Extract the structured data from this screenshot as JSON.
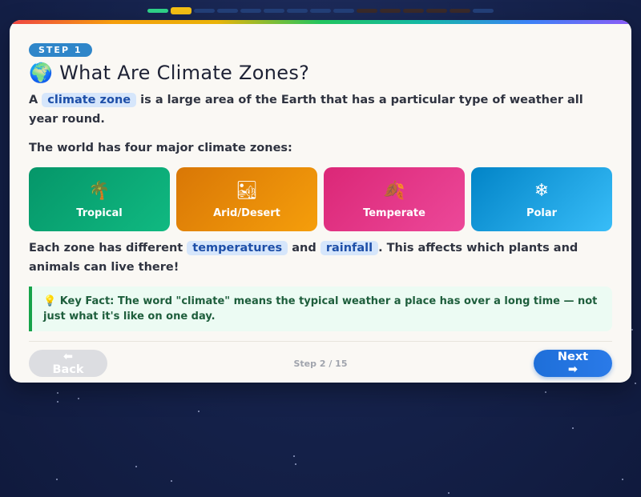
{
  "progress": {
    "total": 15,
    "done": 1,
    "current": 2,
    "dark_from": 10,
    "dark_to": 14
  },
  "step_badge": "STEP 1",
  "title": {
    "icon": "globe-icon",
    "text": "🌍 What Are Climate Zones?"
  },
  "intro": {
    "prefix": "A",
    "highlight": "climate zone",
    "suffix": "is a large area of the Earth that has a particular type of weather all year round."
  },
  "zones_heading": "The world has four major climate zones:",
  "zones": [
    {
      "icon": "🌴",
      "icon_name": "palm-tree-icon",
      "label": "Tropical"
    },
    {
      "icon": "🏜",
      "icon_name": "desert-icon",
      "label": "Arid/Desert"
    },
    {
      "icon": "🍂",
      "icon_name": "leaf-icon",
      "label": "Temperate"
    },
    {
      "icon": "❄",
      "icon_name": "snowflake-icon",
      "label": "Polar"
    }
  ],
  "effects": {
    "prefix": "Each zone has different",
    "hl1": "temperatures",
    "mid": "and",
    "hl2": "rainfall",
    "suffix": ". This affects which plants and animals can live there!"
  },
  "key_fact": "💡 Key Fact: The word \"climate\" means the typical weather a place has over a long time — not just what it's like on one day.",
  "footer": {
    "back_label": "⬅ Back",
    "step_counter": "Step 2 / 15",
    "next_label": "Next ➡"
  }
}
